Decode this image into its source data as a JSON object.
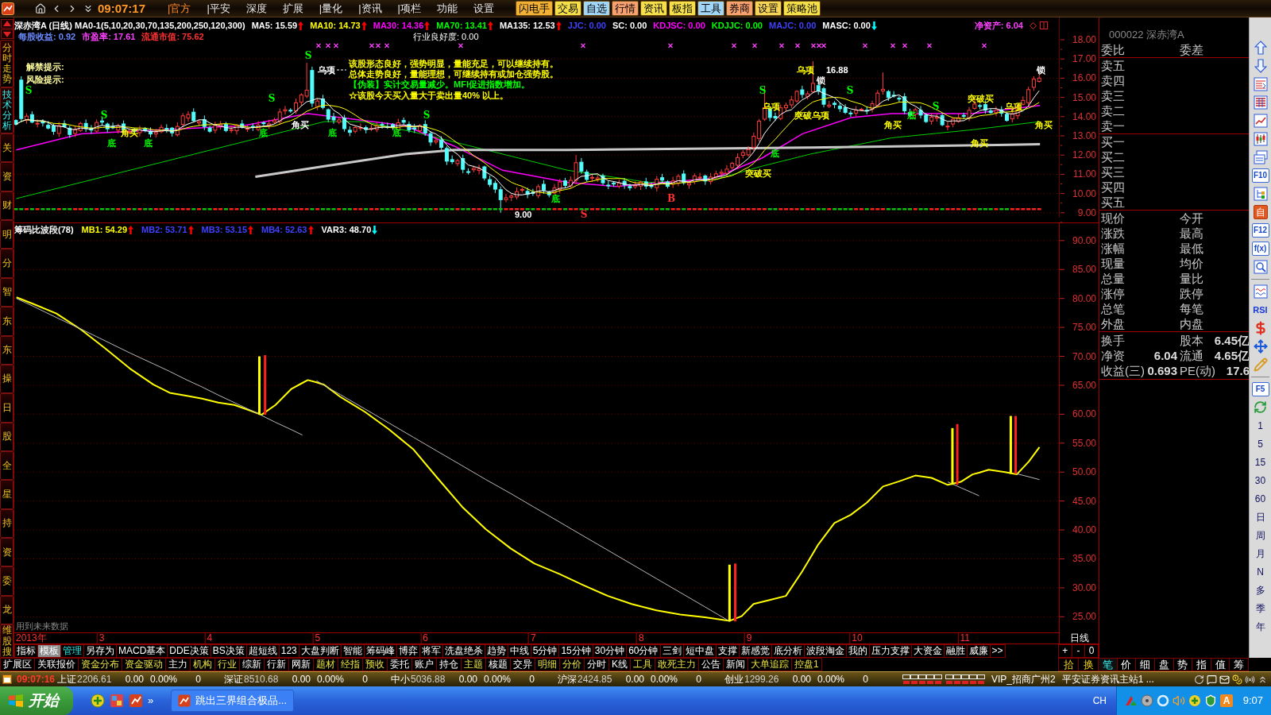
{
  "toolbar": {
    "time": "09:07:17",
    "menu": [
      {
        "label": "|官方",
        "selected": true
      },
      {
        "label": "|平安",
        "selected": false
      },
      {
        "label": "深度",
        "selected": false
      },
      {
        "label": "扩展",
        "selected": false
      },
      {
        "label": "|量化",
        "selected": false
      },
      {
        "label": "|资讯",
        "selected": false
      },
      {
        "label": "|项栏",
        "selected": false
      },
      {
        "label": "功能",
        "selected": false
      },
      {
        "label": "设置",
        "selected": false
      }
    ],
    "quick_buttons": [
      {
        "label": "闪电手",
        "color": "#f2b134"
      },
      {
        "label": "交易",
        "color": "#f6e04a"
      },
      {
        "label": "自选",
        "color": "#a2d6f7"
      },
      {
        "label": "行情",
        "color": "#f7a070"
      },
      {
        "label": "资讯",
        "color": "#f6e04a"
      },
      {
        "label": "板指",
        "color": "#f6e04a"
      },
      {
        "label": "工具",
        "color": "#a2d6f7"
      },
      {
        "label": "券商",
        "color": "#f7a070"
      },
      {
        "label": "设置",
        "color": "#f6d458"
      },
      {
        "label": "策略池",
        "color": "#f6e04a"
      }
    ]
  },
  "left_tabs": [
    {
      "label": "分时走势",
      "selected": false
    },
    {
      "label": "技术分析",
      "selected": true
    },
    {
      "label": "关",
      "selected": false
    },
    {
      "label": "资",
      "selected": false
    },
    {
      "label": "财",
      "selected": false
    },
    {
      "label": "明",
      "selected": false
    },
    {
      "label": "分",
      "selected": false
    },
    {
      "label": "智",
      "selected": false
    },
    {
      "label": "东",
      "selected": false
    },
    {
      "label": "东",
      "selected": false
    },
    {
      "label": "操",
      "selected": false
    },
    {
      "label": "日",
      "selected": false
    },
    {
      "label": "股",
      "selected": false
    },
    {
      "label": "全",
      "selected": false
    },
    {
      "label": "星",
      "selected": false
    },
    {
      "label": "持",
      "selected": false
    },
    {
      "label": "资",
      "selected": false
    },
    {
      "label": "委",
      "selected": false
    },
    {
      "label": "龙",
      "selected": false
    },
    {
      "label": "维股搜",
      "selected": false
    }
  ],
  "upper_chart": {
    "title_row": [
      {
        "text": "深赤湾A (日线) MA0-1(5,10,20,30,70,135,200,250,120,300)",
        "color": "#ffffff"
      },
      {
        "text": "MA5: 15.59",
        "color": "#ffffff",
        "arrow": {
          "kind": "up",
          "color": "#ff0000"
        }
      },
      {
        "text": "MA10: 14.73",
        "color": "#ffff00",
        "arrow": {
          "kind": "up",
          "color": "#ff0000"
        }
      },
      {
        "text": "MA30: 14.36",
        "color": "#ff00ff",
        "arrow": {
          "kind": "up",
          "color": "#ff0000"
        }
      },
      {
        "text": "MA70: 13.41",
        "color": "#00ff00",
        "arrow": {
          "kind": "up",
          "color": "#ff0000"
        }
      },
      {
        "text": "MA135: 12.53",
        "color": "#ffffff",
        "arrow": {
          "kind": "up",
          "color": "#ff0000"
        }
      },
      {
        "text": "JJC: 0.00",
        "color": "#4040ff"
      },
      {
        "text": "SC: 0.00",
        "color": "#ffffff"
      },
      {
        "text": "KDJSC: 0.00",
        "color": "#ff00ff"
      },
      {
        "text": "KDJJC: 0.00",
        "color": "#00ff00"
      },
      {
        "text": "MAJC: 0.00",
        "color": "#4040ff"
      },
      {
        "text": "MASC: 0.00",
        "color": "#ffffff",
        "arrow": {
          "kind": "down",
          "color": "#00ffff"
        }
      }
    ],
    "net_asset": {
      "text": "净资产: 6.04",
      "color": "#ff40ff"
    },
    "info_row": [
      {
        "text": "每股收益: 0.92",
        "color": "#6a8aff"
      },
      {
        "text": "市盈率: 17.61",
        "color": "#ff40ff"
      },
      {
        "text": "流通市值: 75.62",
        "color": "#ff3030"
      }
    ],
    "industry": "行业良好度: 0.00",
    "tips": [
      {
        "text": "解禁提示:",
        "color": "#ffffa0"
      },
      {
        "text": "风险提示:",
        "color": "#ffffa0"
      },
      {
        "text": "该股形态良好，强势明显，量能充足，可以继续持有。",
        "color": "#ffff00"
      },
      {
        "text": "总体走势良好，量能理想，可继续持有或加仓强势股。",
        "color": "#ffff00"
      },
      {
        "text": "【伪装】实计交易量减少。MFI促进指数增加。",
        "color": "#00ff00"
      },
      {
        "text": "☆该股今天买入量大于卖出量40% 以上。",
        "color": "#ffff00"
      }
    ],
    "annotations": [
      {
        "kind": "signal",
        "text": "S",
        "color": "#00ff00"
      },
      {
        "kind": "label",
        "text": "乌项",
        "color": "#ffffff"
      },
      {
        "kind": "label",
        "text": "乌项",
        "color": "#ffff00"
      },
      {
        "kind": "label",
        "text": "16.88",
        "color": "#ffffff"
      },
      {
        "kind": "label",
        "text": "锁",
        "color": "#ffffff"
      },
      {
        "kind": "label",
        "text": "锁",
        "color": "#ffffff"
      },
      {
        "kind": "signal",
        "text": "S",
        "color": "#00ff00"
      },
      {
        "kind": "signal",
        "text": "S",
        "color": "#00ff00"
      },
      {
        "kind": "signal",
        "text": "S",
        "color": "#00ff00"
      },
      {
        "kind": "signal",
        "text": "S",
        "color": "#00ff00"
      },
      {
        "kind": "label",
        "text": "突破买",
        "color": "#ffff00"
      },
      {
        "kind": "label",
        "text": "乌项",
        "color": "#ffff00"
      },
      {
        "kind": "signal",
        "text": "S",
        "color": "#00ff00"
      },
      {
        "kind": "label",
        "text": "乌项",
        "color": "#ffff00"
      },
      {
        "kind": "signal",
        "text": "S",
        "color": "#00ff00"
      },
      {
        "kind": "signal",
        "text": "S",
        "color": "#00ff00"
      },
      {
        "kind": "label",
        "text": "突破乌项",
        "color": "#ffff00"
      },
      {
        "kind": "label",
        "text": "底",
        "color": "#00ff00"
      },
      {
        "kind": "label",
        "text": "角买",
        "color": "#ffffff"
      },
      {
        "kind": "label",
        "text": "角买",
        "color": "#ffff00"
      },
      {
        "kind": "label",
        "text": "角买",
        "color": "#ffff00"
      },
      {
        "kind": "label",
        "text": "角买",
        "color": "#ffff00"
      },
      {
        "kind": "label",
        "text": "底",
        "color": "#00ff00"
      },
      {
        "kind": "label",
        "text": "底",
        "color": "#00ff00"
      },
      {
        "kind": "label",
        "text": "底",
        "color": "#00ff00"
      },
      {
        "kind": "label",
        "text": "底",
        "color": "#00ff00"
      },
      {
        "kind": "label",
        "text": "底",
        "color": "#00ff00"
      },
      {
        "kind": "label",
        "text": "角买",
        "color": "#ffff00"
      },
      {
        "kind": "label",
        "text": "底",
        "color": "#00ff00"
      },
      {
        "kind": "label",
        "text": "突破买",
        "color": "#ffff00"
      },
      {
        "kind": "label",
        "text": "底",
        "color": "#00ff00"
      },
      {
        "kind": "signal",
        "text": "B",
        "color": "#ff3030"
      },
      {
        "kind": "label",
        "text": "9.00",
        "color": "#ffffff"
      },
      {
        "kind": "signal",
        "text": "S",
        "color": "#ff3030"
      }
    ],
    "price_axis": [
      "18.00",
      "17.00",
      "16.00",
      "15.00",
      "14.00",
      "13.00",
      "12.00",
      "11.00",
      "10.00",
      "9.00"
    ]
  },
  "lower_chart": {
    "header": [
      {
        "text": "筹码比波段(78)"
      },
      {
        "text": "MB1: 54.29",
        "color": "#ffff00",
        "arrow": {
          "kind": "up",
          "color": "#ff0000"
        }
      },
      {
        "text": "MB2: 53.71",
        "color": "#4040ff",
        "arrow": {
          "kind": "up",
          "color": "#ff0000"
        }
      },
      {
        "text": "MB3: 53.15",
        "color": "#4040ff",
        "arrow": {
          "kind": "up",
          "color": "#ff0000"
        }
      },
      {
        "text": "MB4: 52.63",
        "color": "#4040ff",
        "arrow": {
          "kind": "up",
          "color": "#ff0000"
        }
      },
      {
        "text": "VAR3: 48.70",
        "color": "#ffffff",
        "arrow": {
          "kind": "down",
          "color": "#00ffff"
        }
      }
    ],
    "note": "用到未来数据",
    "year_label": "2013年",
    "chart_data": {
      "type": "line",
      "grid": true,
      "xlim": [
        2.19,
        11.87
      ],
      "ylim": [
        22.3,
        93.0
      ],
      "xticks": [
        3,
        4,
        5,
        6,
        7,
        8,
        9,
        10,
        11
      ],
      "yticks": [
        {
          "value": 90,
          "label": "90.00"
        },
        {
          "value": 85,
          "label": "85.00"
        },
        {
          "value": 80,
          "label": "80.00"
        },
        {
          "value": 75,
          "label": "75.00"
        },
        {
          "value": 70,
          "label": "70.00"
        },
        {
          "value": 65,
          "label": "65.00"
        },
        {
          "value": 60,
          "label": "60.00"
        },
        {
          "value": 55,
          "label": "55.00"
        },
        {
          "value": 50,
          "label": "50.00"
        },
        {
          "value": 45,
          "label": "45.00"
        },
        {
          "value": 40,
          "label": "40.00"
        },
        {
          "value": 35,
          "label": "35.00"
        },
        {
          "value": 30,
          "label": "30.00"
        },
        {
          "value": 25,
          "label": "25.00"
        }
      ],
      "x": [
        2.21,
        2.36,
        2.58,
        2.81,
        3.03,
        3.26,
        3.48,
        3.63,
        3.78,
        3.93,
        4.08,
        4.23,
        4.38,
        4.48,
        4.61,
        4.76,
        4.86,
        4.91,
        4.99,
        5.06,
        5.21,
        5.44,
        5.66,
        5.89,
        6.11,
        6.34,
        6.56,
        6.79,
        7.01,
        7.24,
        7.46,
        7.69,
        7.91,
        8.14,
        8.36,
        8.59,
        8.82,
        8.93,
        9.04,
        9.19,
        9.34,
        9.49,
        9.64,
        9.79,
        9.94,
        10.09,
        10.24,
        10.39,
        10.54,
        10.69,
        10.84,
        10.96,
        11.07,
        11.13,
        11.22,
        11.37,
        11.48,
        11.59,
        11.69
      ],
      "series": [
        {
          "color": "#ffff00",
          "values": [
            80.2,
            79.1,
            77.4,
            74.6,
            71.4,
            67.9,
            65.1,
            63.7,
            63.2,
            62.7,
            62.0,
            61.6,
            60.6,
            59.9,
            61.6,
            64.4,
            65.4,
            65.9,
            65.5,
            65.1,
            63.0,
            60.4,
            57.4,
            53.9,
            49.0,
            44.0,
            40.1,
            36.8,
            34.2,
            32.4,
            30.5,
            28.6,
            27.2,
            26.1,
            25.4,
            24.9,
            24.3,
            25.1,
            27.2,
            27.9,
            28.6,
            32.8,
            37.5,
            41.2,
            42.6,
            44.7,
            47.5,
            48.4,
            49.4,
            49.0,
            47.8,
            48.3,
            49.6,
            49.9,
            50.4,
            50.0,
            49.6,
            51.8,
            54.3
          ]
        },
        {
          "color": "#b8b8b8",
          "values": [
            80.0,
            78.7,
            76.7,
            74.7,
            72.7,
            70.6,
            68.7,
            67.4,
            66.0,
            64.7,
            63.3,
            62.0,
            60.7,
            59.8,
            58.6,
            57.3,
            56.4,
            null,
            65.8,
            65.0,
            63.4,
            60.9,
            58.5,
            56.0,
            53.6,
            51.1,
            48.7,
            46.3,
            43.9,
            41.4,
            39.0,
            36.5,
            34.1,
            31.6,
            29.2,
            26.7,
            24.2,
            null,
            null,
            null,
            null,
            null,
            null,
            null,
            null,
            null,
            null,
            null,
            null,
            null,
            48.3,
            47.3,
            46.4,
            45.9,
            null,
            null,
            49.7,
            49.2,
            48.7
          ]
        }
      ]
    }
  },
  "period_label": "日线",
  "formula_bar": [
    {
      "label": "指标",
      "selected": false,
      "highlighted": false
    },
    {
      "label": "模板",
      "selected": true,
      "highlighted": false
    },
    {
      "label": "管理",
      "selected": false,
      "highlighted": true
    },
    {
      "label": "另存为",
      "selected": false,
      "highlighted": false
    },
    {
      "label": "MACD基本",
      "selected": false,
      "highlighted": false
    },
    {
      "label": "DDE决策",
      "selected": false,
      "highlighted": false
    },
    {
      "label": "BS决策",
      "selected": false,
      "highlighted": false
    },
    {
      "label": "超短线",
      "selected": false,
      "highlighted": false
    },
    {
      "label": "123",
      "selected": false,
      "highlighted": false
    },
    {
      "label": "大盘判断",
      "selected": false,
      "highlighted": false
    },
    {
      "label": "智能",
      "selected": false,
      "highlighted": false
    },
    {
      "label": "筹码峰",
      "selected": false,
      "highlighted": false
    },
    {
      "label": "博弈",
      "selected": false,
      "highlighted": false
    },
    {
      "label": "将军",
      "selected": false,
      "highlighted": false
    },
    {
      "label": "洗盘绝杀",
      "selected": false,
      "highlighted": false
    },
    {
      "label": "趋势",
      "selected": false,
      "highlighted": false
    },
    {
      "label": "中线",
      "selected": false,
      "highlighted": false
    },
    {
      "label": "5分钟",
      "selected": false,
      "highlighted": false
    },
    {
      "label": "15分钟",
      "selected": false,
      "highlighted": false
    },
    {
      "label": "30分钟",
      "selected": false,
      "highlighted": false
    },
    {
      "label": "60分钟",
      "selected": false,
      "highlighted": false
    },
    {
      "label": "三剑",
      "selected": false,
      "highlighted": false
    },
    {
      "label": "短中盘",
      "selected": false,
      "highlighted": false
    },
    {
      "label": "支撑",
      "selected": false,
      "highlighted": false
    },
    {
      "label": "新感觉",
      "selected": false,
      "highlighted": false
    },
    {
      "label": "底分析",
      "selected": false,
      "highlighted": false
    },
    {
      "label": "波段淘金",
      "selected": false,
      "highlighted": false
    },
    {
      "label": "我的",
      "selected": false,
      "highlighted": false
    },
    {
      "label": "压力支撑",
      "selected": false,
      "highlighted": false
    },
    {
      "label": "大资金",
      "selected": false,
      "highlighted": false
    },
    {
      "label": "融胜",
      "selected": false,
      "highlighted": false
    },
    {
      "label": "威廉",
      "selected": false,
      "highlighted": false
    },
    {
      "label": ">>",
      "selected": false,
      "highlighted": false
    }
  ],
  "zoom_buttons": [
    "+",
    "-",
    "0"
  ],
  "function_bar": [
    {
      "label": "扩展区",
      "highlighted": false
    },
    {
      "label": "关联报价",
      "highlighted": false
    },
    {
      "label": "资金分布",
      "highlighted": true
    },
    {
      "label": "资金驱动",
      "highlighted": true
    },
    {
      "label": "主力",
      "highlighted": false
    },
    {
      "label": "机构",
      "highlighted": true
    },
    {
      "label": "行业",
      "highlighted": true
    },
    {
      "label": "综新",
      "highlighted": false
    },
    {
      "label": "行新",
      "highlighted": false
    },
    {
      "label": "网新",
      "highlighted": false
    },
    {
      "label": "题材",
      "highlighted": true
    },
    {
      "label": "经指",
      "highlighted": true
    },
    {
      "label": "预收",
      "highlighted": true
    },
    {
      "label": "委托",
      "highlighted": false
    },
    {
      "label": "账户",
      "highlighted": false
    },
    {
      "label": "持仓",
      "highlighted": false
    },
    {
      "label": "主题",
      "highlighted": true
    },
    {
      "label": "核题",
      "highlighted": false
    },
    {
      "label": "交异",
      "highlighted": false
    },
    {
      "label": "明细",
      "highlighted": true
    },
    {
      "label": "分价",
      "highlighted": true
    },
    {
      "label": "分时",
      "highlighted": false
    },
    {
      "label": "K线",
      "highlighted": false
    },
    {
      "label": "工具",
      "highlighted": true
    },
    {
      "label": "敢死主力",
      "highlighted": true
    },
    {
      "label": "公告",
      "highlighted": false
    },
    {
      "label": "新闻",
      "highlighted": false
    },
    {
      "label": "大单追踪",
      "highlighted": true
    },
    {
      "label": "控盘1",
      "highlighted": true
    }
  ],
  "function_bar_right": [
    "拾",
    "换"
  ],
  "detail_tabs": [
    {
      "label": "笔",
      "selected": true
    },
    {
      "label": "价",
      "selected": false
    },
    {
      "label": "细",
      "selected": false
    },
    {
      "label": "盘",
      "selected": false
    },
    {
      "label": "势",
      "selected": false
    },
    {
      "label": "指",
      "selected": false
    },
    {
      "label": "值",
      "selected": false
    },
    {
      "label": "筹",
      "selected": false
    }
  ],
  "quote_panel": {
    "title": "000022 深赤湾A",
    "header": [
      "委比",
      "委差"
    ],
    "asks": [
      "卖五",
      "卖四",
      "卖三",
      "卖二",
      "卖一"
    ],
    "bids": [
      "买一",
      "买二",
      "买三",
      "买四",
      "买五"
    ],
    "quotes": [
      {
        "left": "现价",
        "right": "今开"
      },
      {
        "left": "涨跌",
        "right": "最高"
      },
      {
        "left": "涨幅",
        "right": "最低"
      },
      {
        "left": "现量",
        "right": "均价"
      },
      {
        "left": "总量",
        "right": "量比"
      },
      {
        "left": "涨停",
        "right": "跌停"
      },
      {
        "left": "总笔",
        "right": "每笔"
      },
      {
        "left": "外盘",
        "right": "内盘"
      }
    ],
    "stats": [
      {
        "label": "换手",
        "label2": "股本",
        "value2": "6.45亿"
      },
      {
        "label": "净资",
        "value": "6.04",
        "label2": "流通",
        "value2": "4.65亿"
      },
      {
        "label": "收益(三)",
        "value": "0.693",
        "label2": "PE(动)",
        "value2": "17.6"
      }
    ]
  },
  "side_toolbar": [
    {
      "kind": "up"
    },
    {
      "kind": "down"
    },
    {
      "kind": "sheet"
    },
    {
      "kind": "grid"
    },
    {
      "kind": "trend"
    },
    {
      "kind": "candles"
    },
    {
      "kind": "windows"
    },
    {
      "kind": "key",
      "label": "F10"
    },
    {
      "kind": "tree"
    },
    {
      "kind": "tile",
      "label": "自"
    },
    {
      "kind": "key",
      "label": "F12"
    },
    {
      "kind": "key",
      "label": "f(x)"
    },
    {
      "kind": "search"
    },
    {
      "kind": "separator"
    },
    {
      "kind": "wave"
    },
    {
      "kind": "word",
      "label": "RSI"
    },
    {
      "kind": "dollar"
    },
    {
      "kind": "move"
    },
    {
      "kind": "pencil"
    },
    {
      "kind": "separator"
    },
    {
      "kind": "key",
      "label": "F5"
    },
    {
      "kind": "refresh"
    },
    {
      "kind": "period",
      "label": "1"
    },
    {
      "kind": "period",
      "label": "5"
    },
    {
      "kind": "period",
      "label": "15"
    },
    {
      "kind": "period",
      "label": "30"
    },
    {
      "kind": "period",
      "label": "60"
    },
    {
      "kind": "period",
      "label": "日"
    },
    {
      "kind": "period",
      "label": "周"
    },
    {
      "kind": "period",
      "label": "月"
    },
    {
      "kind": "period",
      "label": "N"
    },
    {
      "kind": "period",
      "label": "多"
    },
    {
      "kind": "period",
      "label": "季"
    },
    {
      "kind": "period",
      "label": "年"
    }
  ],
  "status_bar": {
    "time": "09:07:16",
    "indices": [
      {
        "name": "上证",
        "value": "2206.61",
        "change": "0.00",
        "percent": "0.00%",
        "volume": "0"
      },
      {
        "name": "深证",
        "value": "8510.68",
        "change": "0.00",
        "percent": "0.00%",
        "volume": "0"
      },
      {
        "name": "中小",
        "value": "5036.88",
        "change": "0.00",
        "percent": "0.00%",
        "volume": "0"
      },
      {
        "name": "沪深",
        "value": "2424.85",
        "change": "0.00",
        "percent": "0.00%",
        "volume": "0"
      },
      {
        "name": "创业",
        "value": "1299.26",
        "change": "0.00",
        "percent": "0.00%",
        "volume": "0"
      }
    ],
    "servers": [
      "VIP_招商广州2",
      "平安证券资讯主站1 ..."
    ]
  },
  "taskbar": {
    "start": "开始",
    "more": "»",
    "task": "跳出三界组合极品...",
    "language": "CH",
    "tray_badge": "A",
    "clock": "9:07"
  }
}
